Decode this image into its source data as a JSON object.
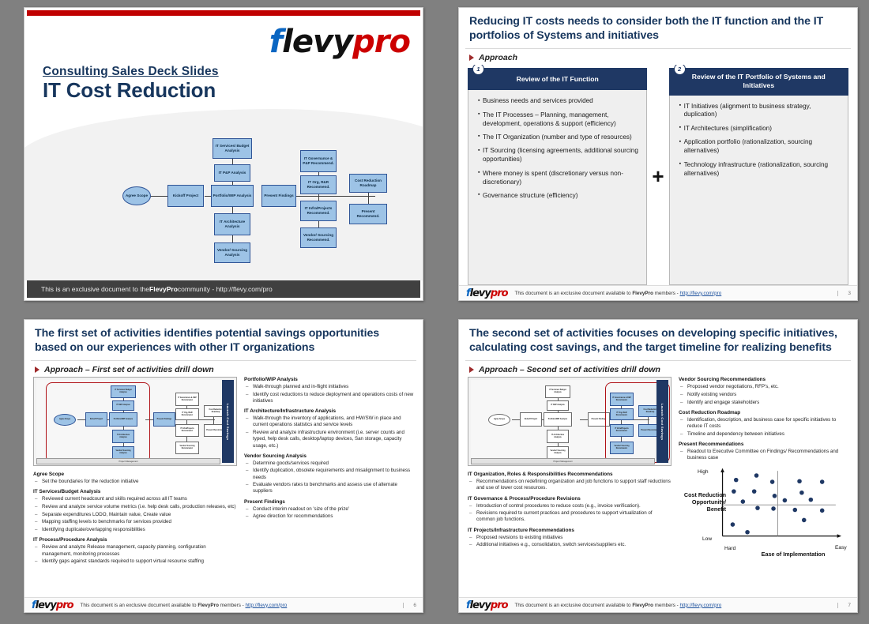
{
  "brand": {
    "logo_f": "f",
    "logo_levy": "levy",
    "logo_pro": "pro"
  },
  "slide1": {
    "subtitle": "Consulting Sales Deck Slides",
    "title": "IT Cost Reduction",
    "footer_pre": "This is an exclusive document to the ",
    "footer_bold": "FlevyPro",
    "footer_post": " community - http://flevy.com/pro",
    "flow": {
      "agree_scope": "Agree Scope",
      "kickoff": "Kickoff Project",
      "it_services": "IT Services/ Budget Analysis",
      "it_pp": "IT P&P Analysis",
      "portfolio": "Portfolio/WIP Analysis",
      "it_arch": "IT Architecture Analysis",
      "vendor_sourcing": "Vendor/ Sourcing Analysis",
      "present_findings": "Present Findings",
      "it_gov": "IT Governance & P&P Recommend.",
      "it_org": "IT Org, R&R Recommend.",
      "it_infra": "IT Infra/Projects Recommend.",
      "vendor_rec": "Vendor/ Sourcing Recommend.",
      "roadmap": "Cost Reduction Roadmap",
      "present_rec": "Present Recommend."
    }
  },
  "slide2": {
    "title": "Reducing IT costs needs to consider both the IT function and the IT portfolios of Systems and initiatives",
    "approach": "Approach",
    "plus": "+",
    "panels": [
      {
        "num": "1",
        "header": "Review of the IT Function",
        "items": [
          "Business needs and services provided",
          "The IT Processes – Planning, management, development, operations & support (efficiency)",
          "The IT Organization (number and type of resources)",
          "IT Sourcing (licensing agreements, additional sourcing opportunities)",
          "Where money is spent (discretionary versus non-discretionary)",
          "Governance structure (efficiency)"
        ]
      },
      {
        "num": "2",
        "header": "Review of the IT Portfolio of Systems and Initiatives",
        "items": [
          "IT Initiatives (alignment to business strategy, duplication)",
          "IT Architectures (simplification)",
          "Application portfolio (rationalization, sourcing alternatives)",
          "Technology infrastructure (rationalization, sourcing alternatives)"
        ]
      }
    ],
    "footer_pre": "This document is an exclusive document available to ",
    "footer_bold": "FlevyPro",
    "footer_mid": " members - ",
    "footer_link": "http://flevy.com/pro",
    "page": "3"
  },
  "slide3": {
    "title": "The first set of activities identifies potential savings opportunities based on our experiences with other IT organizations",
    "approach": "Approach – First set of activities drill down",
    "mini_bar": "Launch Cost Savings",
    "mini_pm": "Project Management",
    "left_groups": [
      {
        "heading": "Agree Scope",
        "items": [
          "Set the boundaries for the reduction initiative"
        ]
      },
      {
        "heading": "IT Services/Budget Analysis",
        "items": [
          "Reviewed current headcount and skills required across all IT teams",
          "Review and analyze service volume metrics (i.e. help desk calls, production releases, etc)",
          "Separate expenditures LODO, Maintain value, Create value",
          "Mapping staffing levels to benchmarks for services provided",
          "Identifying duplicate/overlapping responsibilities"
        ]
      },
      {
        "heading": "IT Process/Procedure Analysis",
        "items": [
          "Review and analyze Release management, capacity planning, configuration management, monitoring processes",
          "Identify gaps against standards required to support virtual resource staffing"
        ]
      }
    ],
    "right_groups": [
      {
        "heading": "Portfolio/WIP Analysis",
        "items": [
          "Walk-through planned and in-flight initiatives",
          "Identify cost reductions to reduce deployment and operations costs of new initiatives"
        ]
      },
      {
        "heading": "IT Architecture/Infrastructure Analysis",
        "items": [
          "Walk-through the inventory of applications, and HW/SW in place and current operations statistics and service levels",
          "Review and analyze infrastructure environment (i.e. server counts and typed, help desk calls, desktop/laptop devices, San storage, capacity usage, etc.)"
        ]
      },
      {
        "heading": "Vendor Sourcing Analysis",
        "items": [
          "Determine goods/services required",
          "Identify duplication, obsolete requirements and misalignment to business needs",
          "Evaluate vendors rates to benchmarks and assess use of alternate suppliers"
        ]
      },
      {
        "heading": "Present Findings",
        "items": [
          "Conduct interim readout on 'size of the prize'",
          "Agree direction for recommendations"
        ]
      }
    ],
    "footer_pre": "This document is an exclusive document available to ",
    "footer_bold": "FlevyPro",
    "footer_mid": " members - ",
    "footer_link": "http://flevy.com/pro",
    "page": "6"
  },
  "slide4": {
    "title": "The second set of activities focuses on developing specific initiatives, calculating cost savings, and the target timeline for realizing benefits",
    "approach": "Approach – Second set of activities drill down",
    "mini_bar": "Launch Cost Savings",
    "mini_pm": "Project Management",
    "left_groups": [
      {
        "heading": "IT Organization, Roles & Responsibilities Recommendations",
        "items": [
          "Recommendations on redefining organization and job functions to support staff reductions and use of lower cost resources."
        ]
      },
      {
        "heading": "IT Governance & Process/Procedure Revisions",
        "items": [
          "Introduction of control procedures to reduce costs (e.g., invoice verification).",
          "Revisions required to current practices and procedures to support virtualization of common job functions."
        ]
      },
      {
        "heading": "IT Projects/Infrastructure Recommendations",
        "items": [
          "Proposed revisions to existing initiatives",
          "Additional initiatives e.g., consolidation, switch services/suppliers etc."
        ]
      }
    ],
    "right_groups": [
      {
        "heading": "Vendor Sourcing Recommendations",
        "items": [
          "Proposed vendor negotiations, RFP's, etc.",
          "Notify existing vendors",
          "Identify and engage stakeholders"
        ]
      },
      {
        "heading": "Cost Reduction Roadmap",
        "items": [
          "Identification, description, and business case for specific initiatives to reduce IT costs",
          "Timeline and dependency between initiatives"
        ]
      },
      {
        "heading": "Present Recommendations",
        "items": [
          "Readout to Executive Committee on Findings/ Recommendations and business case"
        ]
      }
    ],
    "footer_pre": "This document is an exclusive document available to ",
    "footer_bold": "FlevyPro",
    "footer_mid": " members - ",
    "footer_link": "http://flevy.com/pro",
    "page": "7"
  },
  "chart_data": {
    "type": "scatter",
    "title": "",
    "xlabel": "Ease of Implementation",
    "ylabel": "Cost Reduction Opportunity/ Benefit",
    "x_ticks": [
      "Hard",
      "Easy"
    ],
    "y_ticks": [
      "Low",
      "High"
    ],
    "xlim": [
      0,
      100
    ],
    "ylim": [
      0,
      100
    ],
    "grid": false,
    "quadrant_lines": {
      "x": 50,
      "y": 50
    },
    "legend": "none",
    "marker_color": "#1f3864",
    "points": [
      {
        "x": 12,
        "y": 88
      },
      {
        "x": 10,
        "y": 70
      },
      {
        "x": 30,
        "y": 95
      },
      {
        "x": 28,
        "y": 70
      },
      {
        "x": 18,
        "y": 54
      },
      {
        "x": 44,
        "y": 85
      },
      {
        "x": 46,
        "y": 63
      },
      {
        "x": 31,
        "y": 44
      },
      {
        "x": 45,
        "y": 43
      },
      {
        "x": 55,
        "y": 56
      },
      {
        "x": 9,
        "y": 18
      },
      {
        "x": 22,
        "y": 6
      },
      {
        "x": 68,
        "y": 86
      },
      {
        "x": 70,
        "y": 68
      },
      {
        "x": 78,
        "y": 57
      },
      {
        "x": 64,
        "y": 41
      },
      {
        "x": 72,
        "y": 25
      },
      {
        "x": 88,
        "y": 85
      },
      {
        "x": 88,
        "y": 40
      }
    ]
  }
}
